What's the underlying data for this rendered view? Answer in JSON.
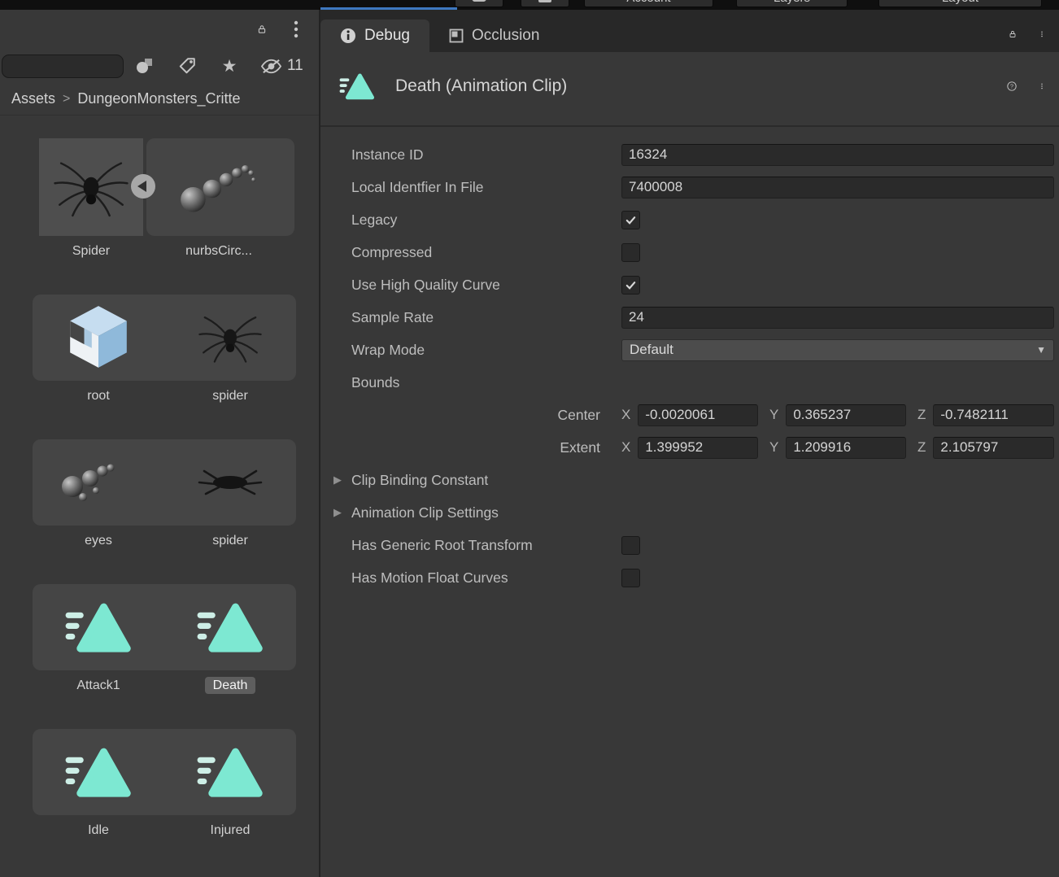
{
  "topbar": {
    "buttons": [
      {
        "label": "Account"
      },
      {
        "label": "Layers"
      },
      {
        "label": "Layout"
      }
    ]
  },
  "icons": {
    "star": "★",
    "dropdown_arrow": "▼",
    "foldout_arrow": "▶",
    "help_qmark": "?",
    "breadcrumb_sep": ">",
    "kebab": "⋮",
    "lock": "padlock",
    "hidden_eye": "eye-slash",
    "label_tag": "tag",
    "type_filter": "shapes",
    "info": "i",
    "subasset_collapse": "◀"
  },
  "project": {
    "search_value": "",
    "hidden_count": "11",
    "breadcrumb": {
      "root": "Assets",
      "current": "DungeonMonsters_Critte"
    },
    "tiles": [
      {
        "label": "Spider"
      },
      {
        "label": "nurbsCirc..."
      },
      {
        "label": "root"
      },
      {
        "label": "spider"
      },
      {
        "label": "eyes"
      },
      {
        "label": "spider"
      },
      {
        "label": "Attack1"
      },
      {
        "label": "Death",
        "selected": true
      },
      {
        "label": "Idle"
      },
      {
        "label": "Injured"
      }
    ]
  },
  "inspector": {
    "tabs": [
      {
        "label": "Debug",
        "active": true
      },
      {
        "label": "Occlusion",
        "active": false
      }
    ],
    "title": "Death (Animation Clip)",
    "rows": {
      "instance_id": {
        "label": "Instance ID",
        "value": "16324"
      },
      "local_identifier": {
        "label": "Local Identfier In File",
        "value": "7400008"
      },
      "legacy": {
        "label": "Legacy",
        "checked": true
      },
      "compressed": {
        "label": "Compressed",
        "checked": false
      },
      "high_quality_curve": {
        "label": "Use High Quality Curve",
        "checked": true
      },
      "sample_rate": {
        "label": "Sample Rate",
        "value": "24"
      },
      "wrap_mode": {
        "label": "Wrap Mode",
        "value": "Default"
      },
      "bounds": {
        "label": "Bounds",
        "axis_labels": {
          "x": "X",
          "y": "Y",
          "z": "Z"
        },
        "center": {
          "label": "Center",
          "x": "-0.0020061",
          "y": "0.365237",
          "z": "-0.7482111"
        },
        "extent": {
          "label": "Extent",
          "x": "1.399952",
          "y": "1.209916",
          "z": "2.105797"
        }
      },
      "clip_binding": {
        "label": "Clip Binding Constant"
      },
      "clip_settings": {
        "label": "Animation Clip Settings"
      },
      "generic_root": {
        "label": "Has Generic Root Transform",
        "checked": false
      },
      "motion_float": {
        "label": "Has Motion Float Curves",
        "checked": false
      }
    }
  }
}
